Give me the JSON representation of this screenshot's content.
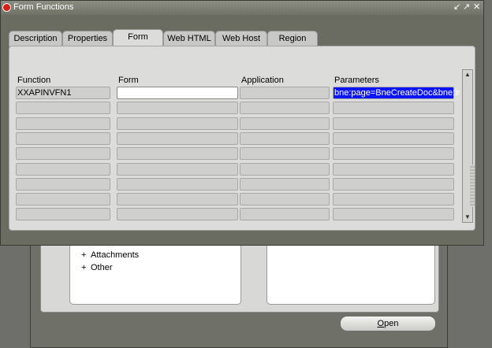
{
  "window": {
    "title": "Form Functions",
    "controls": [
      "↙",
      "↗",
      "✕"
    ]
  },
  "tabs": [
    {
      "label": "Description"
    },
    {
      "label": "Properties"
    },
    {
      "label": "Form",
      "active": true
    },
    {
      "label": "Web HTML"
    },
    {
      "label": "Web Host"
    },
    {
      "label": "Region"
    }
  ],
  "table": {
    "columns": [
      "Function",
      "Form",
      "Application",
      "Parameters"
    ],
    "rows": [
      [
        "XXAPINVFN1",
        "",
        "",
        "bne:page=BneCreateDoc&bne:ir"
      ],
      [
        "",
        "",
        "",
        ""
      ],
      [
        "",
        "",
        "",
        ""
      ],
      [
        "",
        "",
        "",
        ""
      ],
      [
        "",
        "",
        "",
        ""
      ],
      [
        "",
        "",
        "",
        ""
      ],
      [
        "",
        "",
        "",
        ""
      ],
      [
        "",
        "",
        "",
        ""
      ],
      [
        "",
        "",
        "",
        ""
      ]
    ]
  },
  "navigator": {
    "tree_items": [
      {
        "marker": "+",
        "label": "Attachments"
      },
      {
        "marker": "+",
        "label": "Other"
      }
    ],
    "open_button": {
      "first": "O",
      "rest": "pen"
    }
  }
}
